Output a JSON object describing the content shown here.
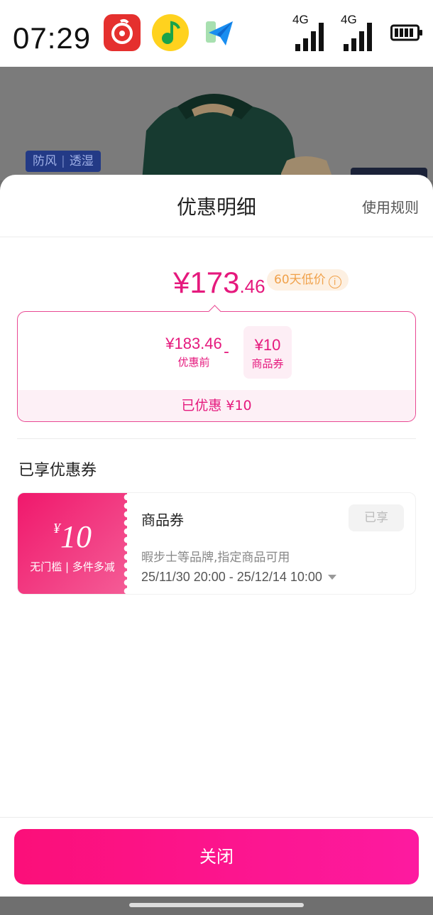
{
  "status_bar": {
    "time": "07:29",
    "apps": [
      "netease-music-icon",
      "qq-music-icon",
      "plane-app-icon"
    ],
    "signal1_label": "4G",
    "signal2_label": "4G",
    "battery": "battery-icon"
  },
  "product": {
    "tag_left": "防风",
    "tag_right": "透湿"
  },
  "sheet": {
    "title": "优惠明细",
    "rules_link": "使用规则",
    "price_symbol_int": "¥173",
    "price_dec": ".46",
    "low_badge": "60天低价",
    "info_glyph": "i",
    "before_amount": "¥183.46",
    "before_label": "优惠前",
    "minus": "-",
    "coupon_amount": "¥10",
    "coupon_label": "商品券",
    "saved": "已优惠 ¥10",
    "section_title": "已享优惠券"
  },
  "coupon": {
    "yen": "¥",
    "amount": "10",
    "condition": "无门槛 | 多件多减",
    "name": "商品券",
    "state": "已享",
    "description": "暇步士等品牌,指定商品可用",
    "validity": "25/11/30 20:00 - 25/12/14 10:00"
  },
  "footer": {
    "close_label": "关闭"
  },
  "colors": {
    "accent": "#e5197d",
    "button": "#fb0f79",
    "badge": "#f0a14a"
  }
}
